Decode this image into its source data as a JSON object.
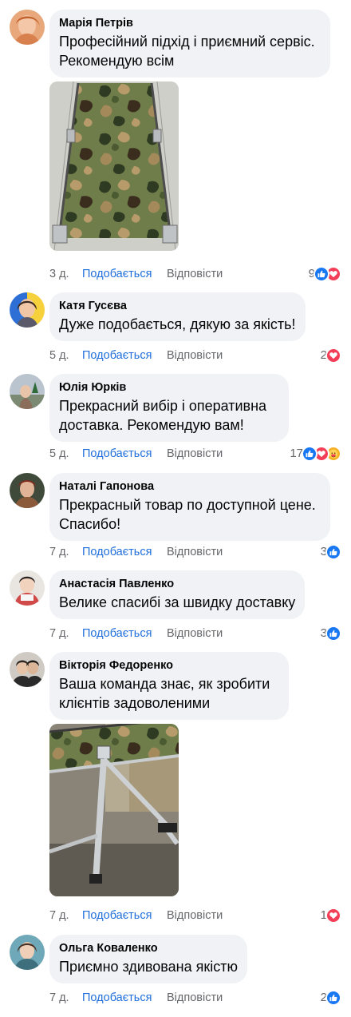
{
  "comments": [
    {
      "author": "Марія Петрів",
      "text": "Професійний підхід і приємний сервіс. Рекомендую всім",
      "time": "3 д.",
      "like_label": "Подобається",
      "reply_label": "Відповісти",
      "reaction_count": "9",
      "reactions": [
        "like-icon",
        "love-icon"
      ],
      "photo": "camouflage-cot-top-view"
    },
    {
      "author": "Катя Гусєва",
      "text": "Дуже подобається, дякую за якість!",
      "time": "5 д.",
      "like_label": "Подобається",
      "reply_label": "Відповісти",
      "reaction_count": "2",
      "reactions": [
        "love-icon"
      ]
    },
    {
      "author": "Юлія Юрків",
      "text": "Прекрасний вибір і оперативна доставка. Рекомендую вам!",
      "time": "5 д.",
      "like_label": "Подобається",
      "reply_label": "Відповісти",
      "reaction_count": "17",
      "reactions": [
        "like-icon",
        "love-icon",
        "care-icon"
      ]
    },
    {
      "author": "Наталі Гапонова",
      "text": "Прекрасный товар по доступной цене. Спасибо!",
      "time": "7 д.",
      "like_label": "Подобається",
      "reply_label": "Відповісти",
      "reaction_count": "3",
      "reactions": [
        "like-icon"
      ]
    },
    {
      "author": "Анастасія Павленко",
      "text": "Велике спасибі за швидку доставку",
      "time": "7 д.",
      "like_label": "Подобається",
      "reply_label": "Відповісти",
      "reaction_count": "3",
      "reactions": [
        "like-icon"
      ]
    },
    {
      "author": "Вікторія Федоренко",
      "text": "Ваша команда знає, як зробити клієнтів задоволеними",
      "time": "7 д.",
      "like_label": "Подобається",
      "reply_label": "Відповісти",
      "reaction_count": "1",
      "reactions": [
        "love-icon"
      ],
      "photo": "camouflage-cot-frame-closeup"
    },
    {
      "author": "Ольга Коваленко",
      "text": "Приємно здивована якістю",
      "time": "7 д.",
      "like_label": "Подобається",
      "reply_label": "Відповісти",
      "reaction_count": "2",
      "reactions": [
        "like-icon"
      ]
    }
  ],
  "colors": {
    "bubble": "#f0f2f5",
    "link": "#216fdb",
    "meta": "#65676b",
    "like": "#1877f2",
    "love": "#f33e58",
    "care": "#f7b125"
  }
}
